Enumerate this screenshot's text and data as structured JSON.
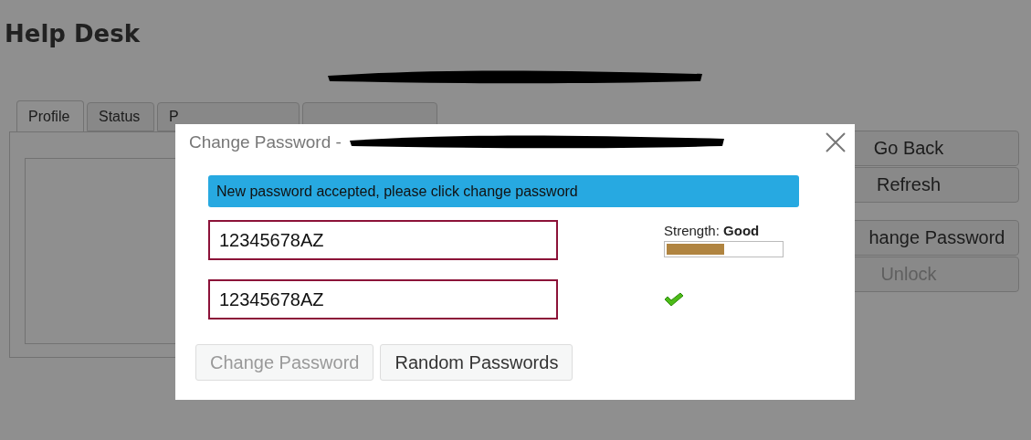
{
  "page": {
    "title": "Help Desk",
    "subtitle_redacted": true
  },
  "tabs": [
    {
      "label": "Profile",
      "selected": true
    },
    {
      "label": "Status",
      "selected": false
    },
    {
      "label": "P",
      "selected": false
    },
    {
      "selected": false
    }
  ],
  "side_button_groups": [
    [
      {
        "label": "Go Back",
        "disabled": false
      },
      {
        "label": "Refresh",
        "disabled": false
      }
    ],
    [
      {
        "label": "hange Password",
        "disabled": false
      },
      {
        "label": "Unlock",
        "disabled": true
      }
    ]
  ],
  "dialog": {
    "title": "Change Password - ",
    "title_redacted": true,
    "alert": "New password accepted, please click change password",
    "fields": [
      {
        "value": "12345678AZ"
      },
      {
        "value": "12345678AZ"
      }
    ],
    "strength": {
      "label": "Strength: **Good**",
      "level": 0.5
    },
    "match": true,
    "buttons": [
      {
        "label": "Change Password",
        "disabled": true
      },
      {
        "label": "Random Passwords",
        "disabled": false
      }
    ]
  }
}
